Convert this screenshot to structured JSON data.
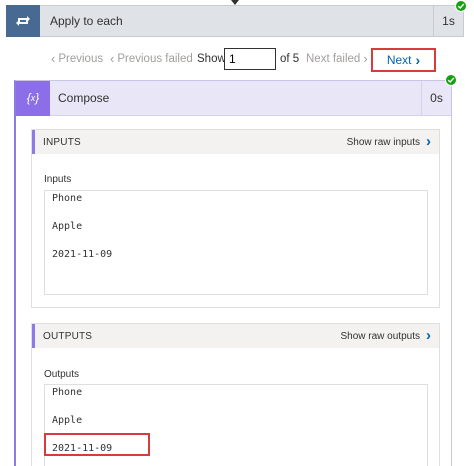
{
  "loop": {
    "title": "Apply to each",
    "duration": "1s",
    "icon": "loop-icon"
  },
  "pager": {
    "previous": "Previous",
    "previous_failed": "Previous failed",
    "show": "Show",
    "current": "1",
    "of": "of 5",
    "next_failed": "Next failed",
    "next": "Next"
  },
  "compose": {
    "title": "Compose",
    "duration": "0s",
    "icon": "compose-icon",
    "inputs": {
      "section_title": "INPUTS",
      "raw_link": "Show raw inputs",
      "label": "Inputs",
      "lines": [
        "Phone",
        "Apple",
        "2021-11-09"
      ]
    },
    "outputs": {
      "section_title": "OUTPUTS",
      "raw_link": "Show raw outputs",
      "label": "Outputs",
      "lines": [
        "Phone",
        "Apple",
        "2021-11-09"
      ]
    }
  },
  "colors": {
    "loop_accent": "#486991",
    "compose_accent": "#8c6ee8",
    "link": "#0063b1",
    "success": "#13a10e",
    "highlight": "#d83b3b"
  }
}
